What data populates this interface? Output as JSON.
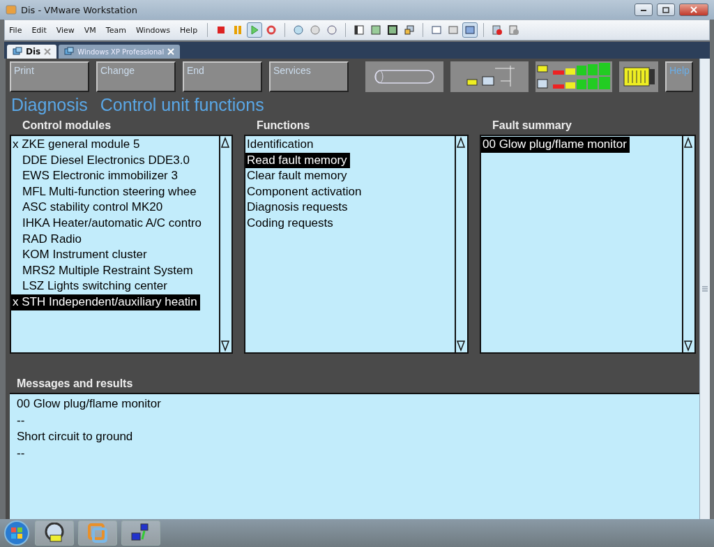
{
  "window": {
    "title": "Dis - VMware Workstation"
  },
  "menu": [
    "File",
    "Edit",
    "View",
    "VM",
    "Team",
    "Windows",
    "Help"
  ],
  "tabs": [
    {
      "label": "Dis",
      "selected": true
    },
    {
      "label": "Windows XP Professional",
      "selected": false
    }
  ],
  "dis": {
    "buttons": [
      "Print",
      "Change",
      "End",
      "Services"
    ],
    "help": "Help",
    "heading": [
      "Diagnosis",
      "Control unit functions"
    ],
    "control_modules": {
      "header": "Control modules",
      "items": [
        {
          "label": "x ZKE general module 5",
          "marked": true,
          "selected": false
        },
        {
          "label": "DDE Diesel Electronics DDE3.0",
          "marked": false,
          "selected": false
        },
        {
          "label": "EWS Electronic immobilizer 3",
          "marked": false,
          "selected": false
        },
        {
          "label": "MFL Multi-function steering whee",
          "marked": false,
          "selected": false
        },
        {
          "label": "ASC stability control MK20",
          "marked": false,
          "selected": false
        },
        {
          "label": "IHKA Heater/automatic A/C contro",
          "marked": false,
          "selected": false
        },
        {
          "label": "RAD Radio",
          "marked": false,
          "selected": false
        },
        {
          "label": "KOM Instrument cluster",
          "marked": false,
          "selected": false
        },
        {
          "label": "MRS2 Multiple Restraint System",
          "marked": false,
          "selected": false
        },
        {
          "label": "LSZ Lights switching center",
          "marked": false,
          "selected": false
        },
        {
          "label": "x STH Independent/auxiliary heatin",
          "marked": true,
          "selected": true
        }
      ]
    },
    "functions": {
      "header": "Functions",
      "items": [
        {
          "label": "Identification",
          "selected": false
        },
        {
          "label": "Read fault memory",
          "selected": true
        },
        {
          "label": "Clear fault memory",
          "selected": false
        },
        {
          "label": "Component activation",
          "selected": false
        },
        {
          "label": "Diagnosis requests",
          "selected": false
        },
        {
          "label": "Coding requests",
          "selected": false
        }
      ]
    },
    "fault_summary": {
      "header": "Fault summary",
      "items": [
        {
          "label": "00 Glow plug/flame monitor",
          "selected": true
        }
      ]
    },
    "messages": {
      "header": "Messages and results",
      "lines": [
        "00 Glow plug/flame monitor",
        "--",
        "Short circuit to ground",
        "--"
      ]
    }
  }
}
